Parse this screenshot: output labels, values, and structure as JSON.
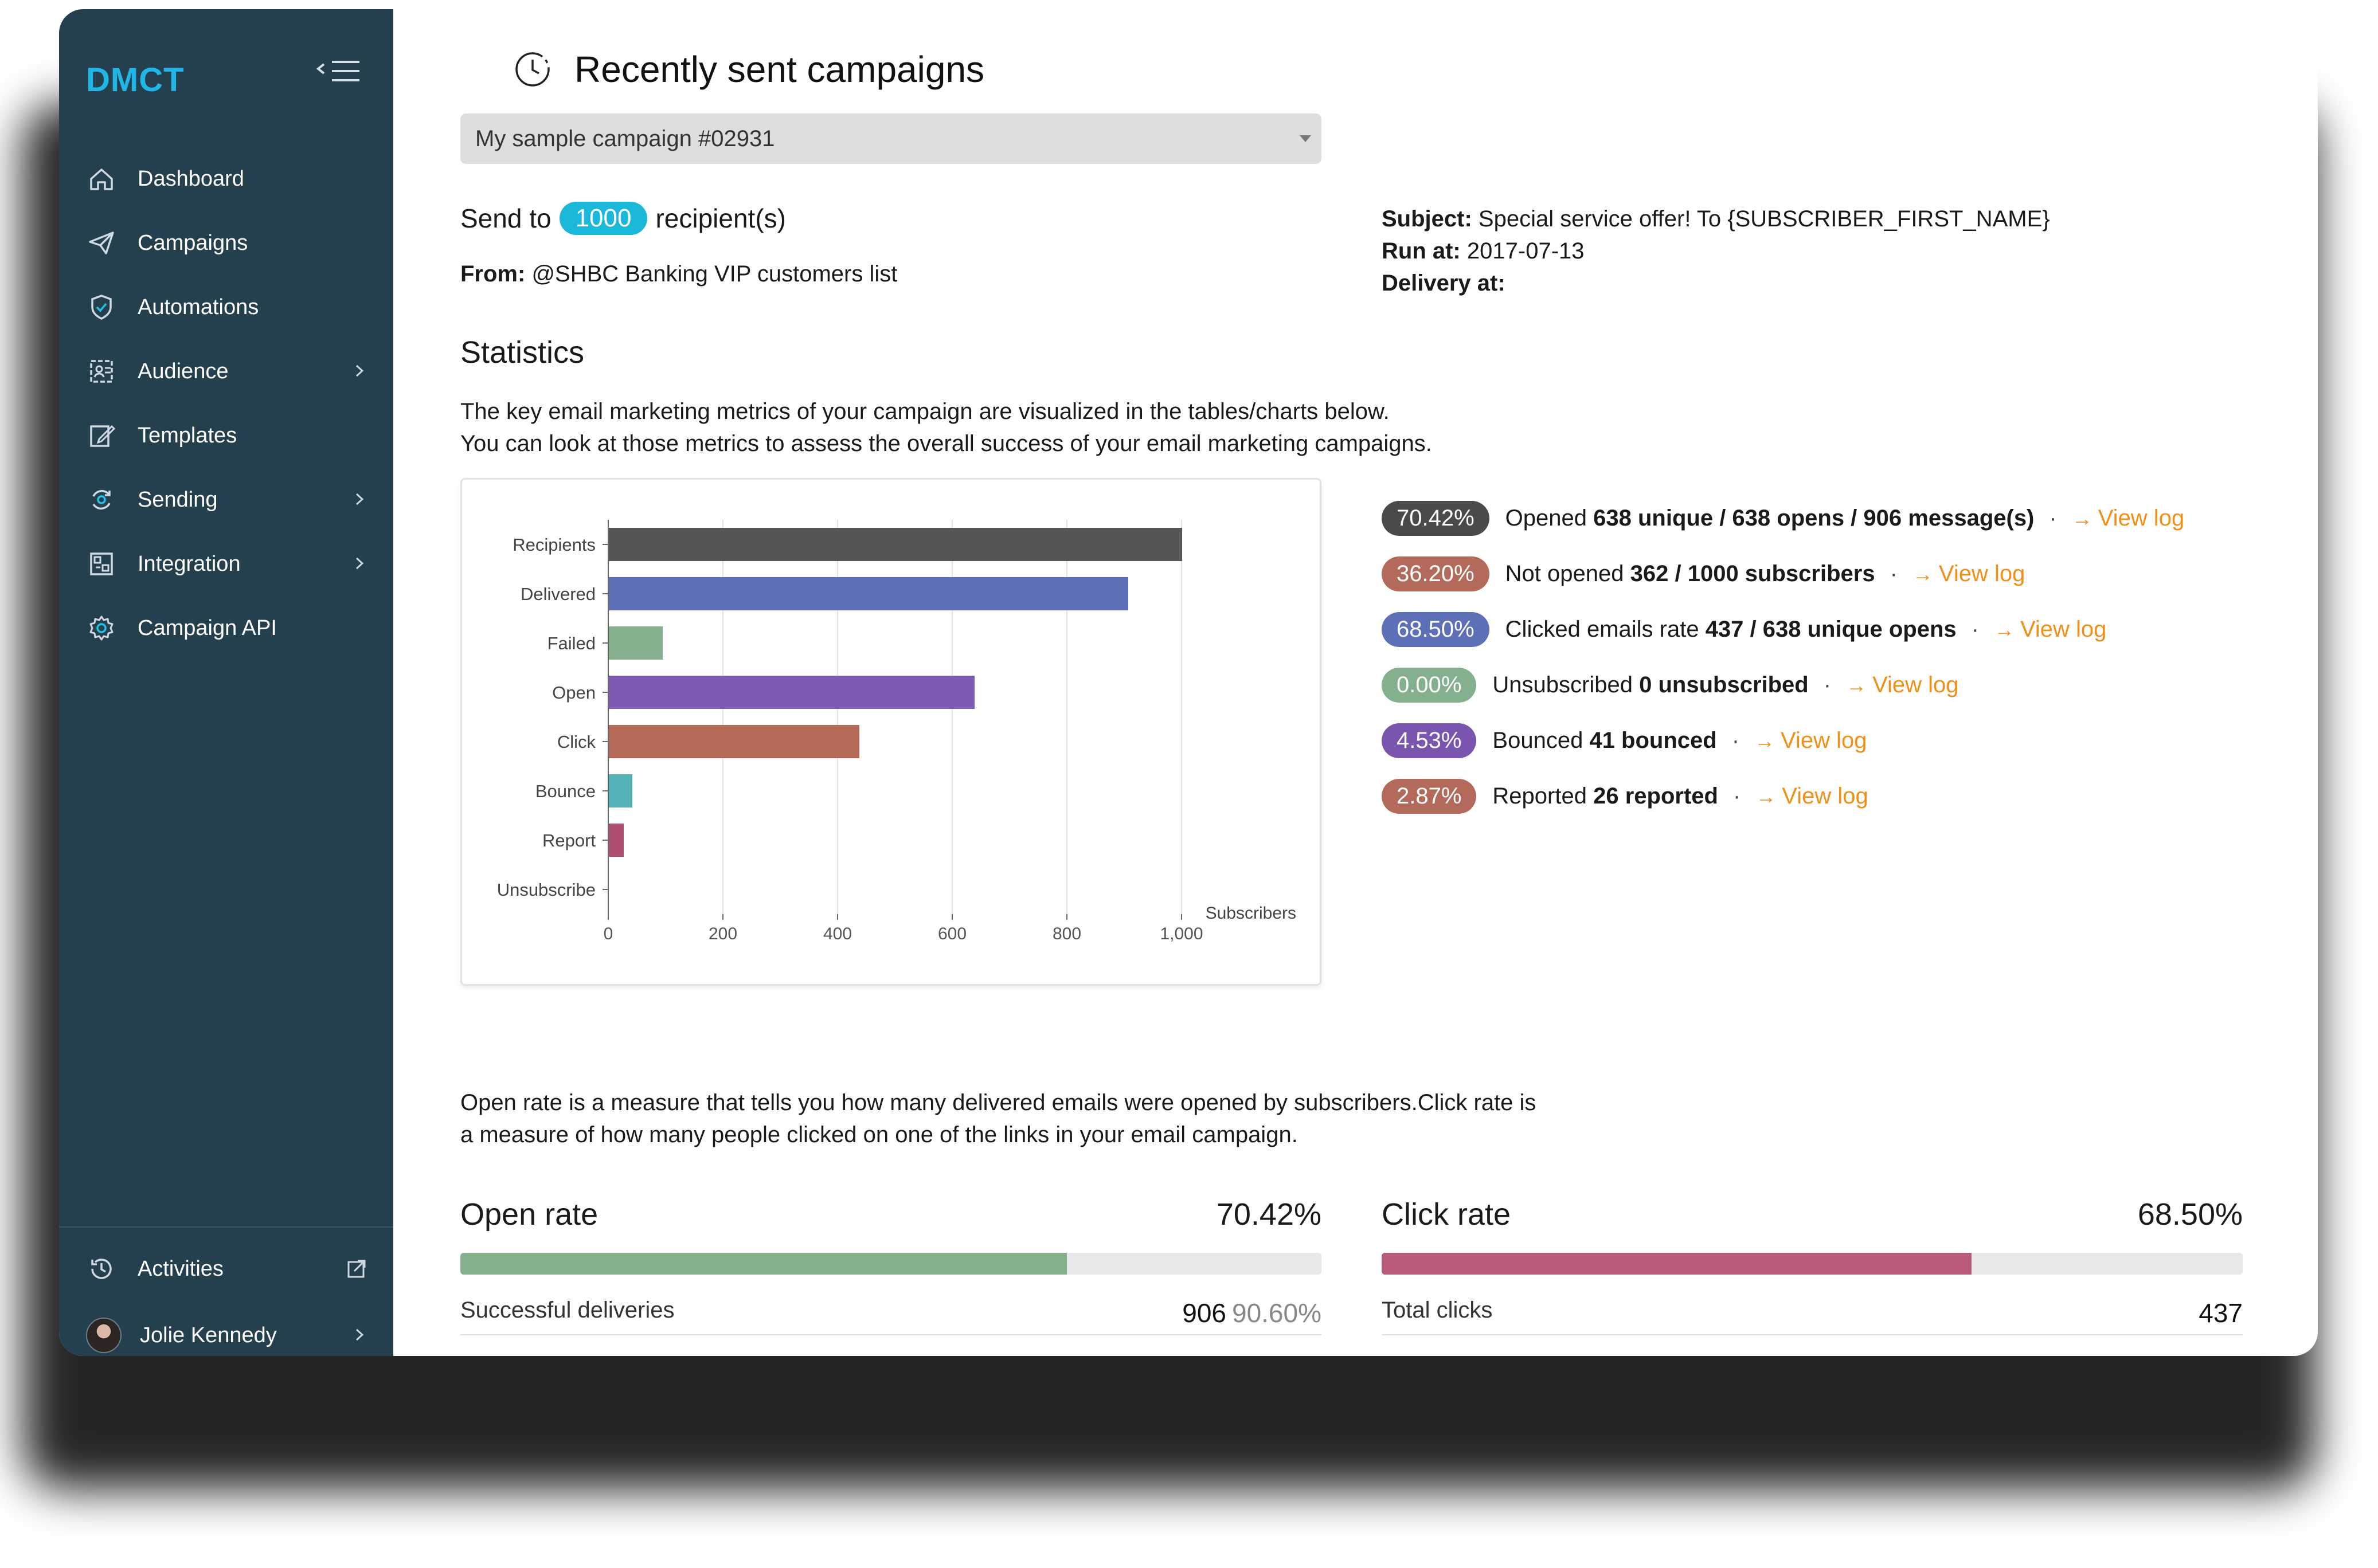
{
  "sidebar": {
    "brand": "DMCT",
    "items": [
      {
        "label": "Dashboard",
        "icon": "home-icon",
        "chevron": false
      },
      {
        "label": "Campaigns",
        "icon": "send-icon",
        "chevron": false
      },
      {
        "label": "Automations",
        "icon": "automation-icon",
        "chevron": false
      },
      {
        "label": "Audience",
        "icon": "audience-icon",
        "chevron": true
      },
      {
        "label": "Templates",
        "icon": "template-icon",
        "chevron": false
      },
      {
        "label": "Sending",
        "icon": "sending-icon",
        "chevron": true
      },
      {
        "label": "Integration",
        "icon": "integration-icon",
        "chevron": true
      },
      {
        "label": "Campaign API",
        "icon": "gear-icon",
        "chevron": false
      }
    ],
    "activities_label": "Activities",
    "user_name": "Jolie Kennedy"
  },
  "main": {
    "title": "Recently sent campaigns",
    "campaign_select": "My sample campaign #02931",
    "send_to_prefix": "Send to",
    "recipient_count": "1000",
    "send_to_suffix": "recipient(s)",
    "from_label": "From:",
    "from_value": "@SHBC Banking VIP customers list",
    "subject_label": "Subject:",
    "subject_value": "Special service offer! To {SUBSCRIBER_FIRST_NAME}",
    "run_at_label": "Run at:",
    "run_at_value": "2017-07-13",
    "delivery_label": "Delivery at:",
    "statistics_title": "Statistics",
    "statistics_desc_1": "The key email marketing metrics of your campaign are visualized in the tables/charts below.",
    "statistics_desc_2": "You can look at those metrics to assess the overall success of your email marketing campaigns.",
    "rate_desc_1": "Open rate is a measure that tells you how many delivered emails were opened by subscribers.Click rate is",
    "rate_desc_2": "a measure of how many people clicked on one of the links in your email campaign."
  },
  "stats": [
    {
      "pct": "70.42%",
      "color": "#4a4a4a",
      "label": "Opened",
      "detail": "638 unique / 638 opens / 906 message(s)",
      "link": "View log"
    },
    {
      "pct": "36.20%",
      "color": "#b46a5a",
      "label": "Not opened",
      "detail": "362 / 1000 subscribers",
      "link": "View log"
    },
    {
      "pct": "68.50%",
      "color": "#5d6fb7",
      "label": "Clicked emails rate",
      "detail": "437 / 638 unique opens",
      "link": "View log"
    },
    {
      "pct": "0.00%",
      "color": "#84b08d",
      "label": "Unsubscribed",
      "detail": "0 unsubscribed",
      "link": "View log"
    },
    {
      "pct": "4.53%",
      "color": "#7a55b0",
      "label": "Bounced",
      "detail": "41 bounced",
      "link": "View log"
    },
    {
      "pct": "2.87%",
      "color": "#b46a5a",
      "label": "Reported",
      "detail": "26 reported",
      "link": "View log"
    }
  ],
  "chart_data": {
    "type": "bar",
    "orientation": "horizontal",
    "categories": [
      "Recipients",
      "Delivered",
      "Failed",
      "Open",
      "Click",
      "Bounce",
      "Report",
      "Unsubscribe"
    ],
    "values": [
      1000,
      906,
      94,
      638,
      437,
      41,
      26,
      0
    ],
    "colors": [
      "#555555",
      "#5d6fb7",
      "#84b08d",
      "#7e5bb2",
      "#b56a58",
      "#55b2b8",
      "#ad4f72",
      "#999999"
    ],
    "xlabel": "Subscribers",
    "xlim": [
      0,
      1000
    ],
    "xticks": [
      "0",
      "200",
      "400",
      "600",
      "800",
      "1,000"
    ],
    "grid": true
  },
  "open_rate": {
    "title": "Open rate",
    "value": "70.42%",
    "fraction": 0.7042,
    "color": "#84b08d",
    "foot_label": "Successful deliveries",
    "foot_num": "906",
    "foot_pct": "90.60%"
  },
  "click_rate": {
    "title": "Click rate",
    "value": "68.50%",
    "fraction": 0.685,
    "color": "#b85a78",
    "foot_label": "Total clicks",
    "foot_num": "437"
  }
}
